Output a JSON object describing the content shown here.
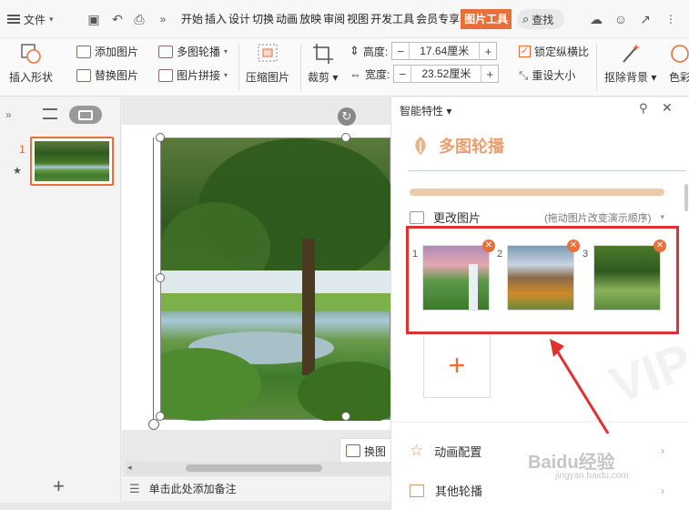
{
  "menu": {
    "file_label": "文件",
    "tabs": [
      "开始",
      "插入",
      "设计",
      "切换",
      "动画",
      "放映",
      "审阅",
      "视图",
      "开发工具",
      "会员专享",
      "图片工具"
    ],
    "search_label": "查找"
  },
  "ribbon": {
    "insert_shape": "插入形状",
    "add_picture": "添加图片",
    "replace_picture": "替换图片",
    "multi_carousel": "多图轮播",
    "picture_collage": "图片拼接",
    "compress_picture": "压缩图片",
    "crop": "裁剪",
    "height_label": "高度:",
    "height_value": "17.64厘米",
    "width_label": "宽度:",
    "width_value": "23.52厘米",
    "lock_ratio": "锁定纵横比",
    "reset_size": "重设大小",
    "remove_bg": "抠除背景",
    "color": "色彩",
    "minus": "−",
    "plus": "+"
  },
  "leftpane": {
    "slide_number": "1",
    "star": "★"
  },
  "notes": {
    "placeholder": "单击此处添加备注"
  },
  "slidearea": {
    "replace_btn": "换图"
  },
  "rightpane": {
    "header": "智能特性",
    "section_title": "多图轮播",
    "change_picture": "更改图片",
    "change_hint": "(拖动图片改变演示顺序)",
    "pictures": [
      {
        "index": "1",
        "desc": "waterfall"
      },
      {
        "index": "2",
        "desc": "mountains"
      },
      {
        "index": "3",
        "desc": "tree"
      }
    ],
    "add_symbol": "+",
    "animation_config": "动画配置",
    "other_carousel": "其他轮播",
    "watermark": "Baidu经验",
    "watermark_url": "jingyan.baidu.com",
    "vip": "VIP"
  }
}
